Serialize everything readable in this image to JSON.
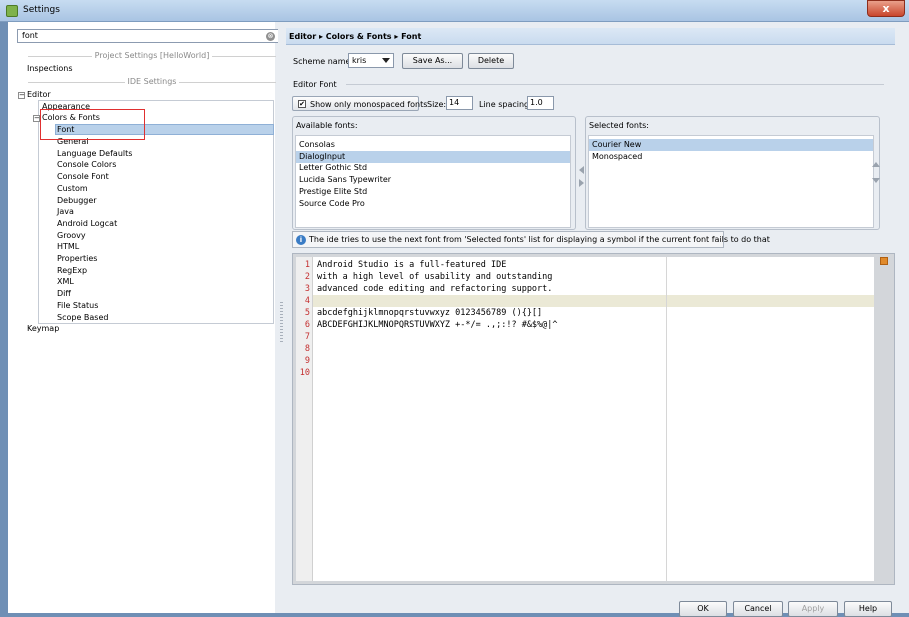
{
  "window": {
    "title": "Settings",
    "close_glyph": "x"
  },
  "search": {
    "value": "font",
    "clear_glyph": "⊗"
  },
  "tree": {
    "project_section": "Project Settings [HelloWorld]",
    "inspections": "Inspections",
    "ide_section": "IDE Settings",
    "editor": "Editor",
    "appearance": "Appearance",
    "colors_fonts": "Colors & Fonts",
    "font": "Font",
    "items": [
      "General",
      "Language Defaults",
      "Console Colors",
      "Console Font",
      "Custom",
      "Debugger",
      "Java",
      "Android Logcat",
      "Groovy",
      "HTML",
      "Properties",
      "RegExp",
      "XML",
      "Diff",
      "File Status",
      "Scope Based"
    ],
    "keymap": "Keymap",
    "collapse_glyph": "−"
  },
  "breadcrumb": "Editor ▸ Colors & Fonts ▸ Font",
  "scheme": {
    "label": "Scheme name:",
    "value": "kris",
    "save_as": "Save As...",
    "delete": "Delete"
  },
  "editor_font": {
    "section": "Editor Font",
    "monospaced_label": "Show only monospaced fonts",
    "monospaced_checked": "✔",
    "size_label": "Size:",
    "size": "14",
    "spacing_label": "Line spacing:",
    "spacing": "1.0"
  },
  "available": {
    "label": "Available fonts:",
    "fonts": [
      "Consolas",
      "DialogInput",
      "Letter Gothic Std",
      "Lucida Sans Typewriter",
      "Prestige Elite Std",
      "Source Code Pro"
    ],
    "selected_index": 1
  },
  "selected": {
    "label": "Selected fonts:",
    "fonts": [
      "Courier New",
      "Monospaced"
    ]
  },
  "info": {
    "icon": "i",
    "text": "The ide tries to use the next font from 'Selected fonts' list for displaying a symbol if the current font fails to do that"
  },
  "preview": {
    "line_numbers": [
      "1",
      "2",
      "3",
      "4",
      "5",
      "6",
      "7",
      "8",
      "9",
      "10"
    ],
    "lines": [
      "Android Studio is a full-featured IDE",
      "with a high level of usability and outstanding",
      "advanced code editing and refactoring support.",
      "",
      "abcdefghijklmnopqrstuvwxyz 0123456789 (){}[]",
      "ABCDEFGHIJKLMNOPQRSTUVWXYZ +-*/= .,;:!? #&$%@|^"
    ]
  },
  "buttons": {
    "ok": "OK",
    "cancel": "Cancel",
    "apply": "Apply",
    "help": "Help"
  }
}
